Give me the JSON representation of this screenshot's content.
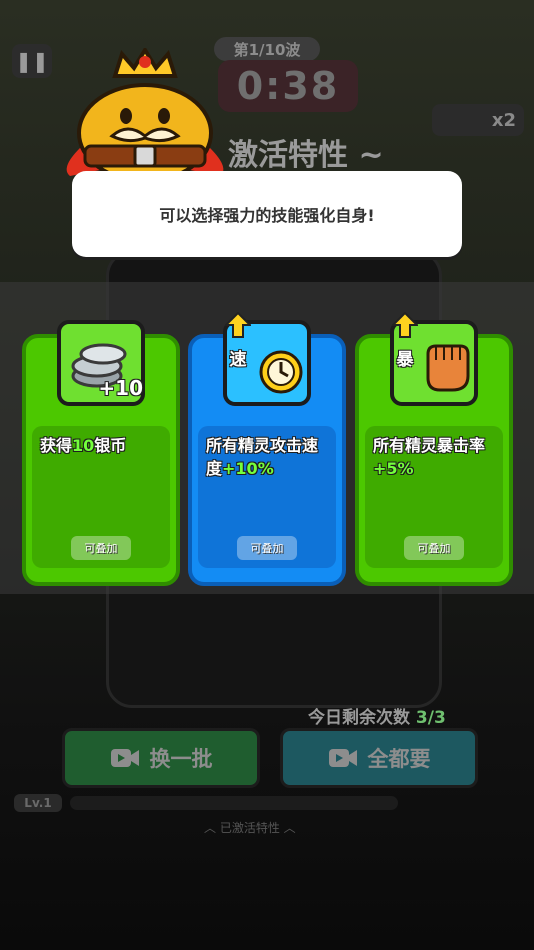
{
  "hud": {
    "pause_icon": "pause-icon",
    "wave": "第1/10波",
    "timer": "0:38",
    "speed_label": "x2"
  },
  "banner": {
    "title": "激活特性 ~"
  },
  "bubble": {
    "text": "可以选择强力的技能强化自身!"
  },
  "cards": [
    {
      "icon": "silver-coins-icon",
      "icon_text": "+10",
      "text_before": "获得",
      "highlight": "10",
      "text_after": "银币",
      "stack": "可叠加",
      "color": "#4cc800"
    },
    {
      "icon": "clock-icon",
      "tag": "速",
      "text_before": "所有精灵攻击速度",
      "highlight": "+10%",
      "text_after": "",
      "stack": "可叠加",
      "color": "#138cf4"
    },
    {
      "icon": "fist-icon",
      "tag": "暴",
      "text_before": "所有精灵暴击率",
      "highlight": "+5%",
      "text_after": "",
      "stack": "可叠加",
      "color": "#4cc800"
    }
  ],
  "footer": {
    "remaining_label": "今日剩余次数",
    "remaining_value": "3/3",
    "reroll_label": "换一批",
    "take_all_label": "全都要",
    "level": "Lv.1",
    "unlocked_label": "已激活特性"
  }
}
